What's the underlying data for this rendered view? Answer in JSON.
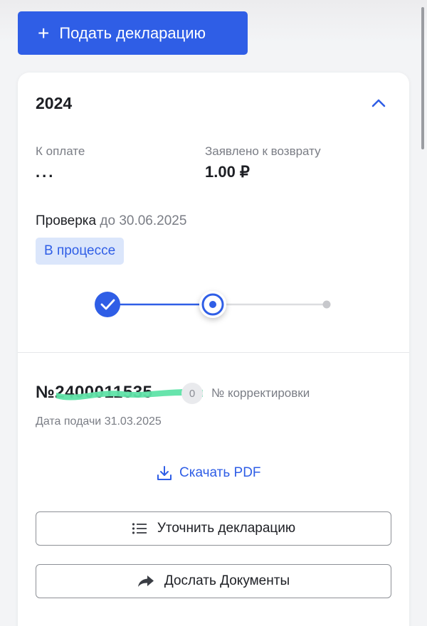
{
  "header": {
    "submit_button_label": "Подать декларацию",
    "submit_button_plus": "+"
  },
  "declaration_card": {
    "year": "2024",
    "to_pay": {
      "label": "К оплате",
      "value": "..."
    },
    "claimed_refund": {
      "label": "Заявлено к возврату",
      "value": "1.00 ₽"
    },
    "check": {
      "title": "Проверка",
      "deadline": "до 30.06.2025"
    },
    "status_badge": "В процессе",
    "progress": {
      "total_steps": 3,
      "completed_steps": 1,
      "current_step": 2
    },
    "declaration": {
      "number_prefix": "№2400011535",
      "correction_number": "0",
      "correction_label": "№ корректировки",
      "submit_date": "Дата подачи 31.03.2025"
    },
    "actions": {
      "download_pdf": "Скачать PDF",
      "refine_declaration": "Уточнить декларацию",
      "send_documents": "Дослать Документы"
    }
  },
  "colors": {
    "accent": "#2f5ee6",
    "badge_bg": "#dbe6fb",
    "muted_text": "#7a7d85",
    "redaction_marker": "#5fe3a8"
  }
}
